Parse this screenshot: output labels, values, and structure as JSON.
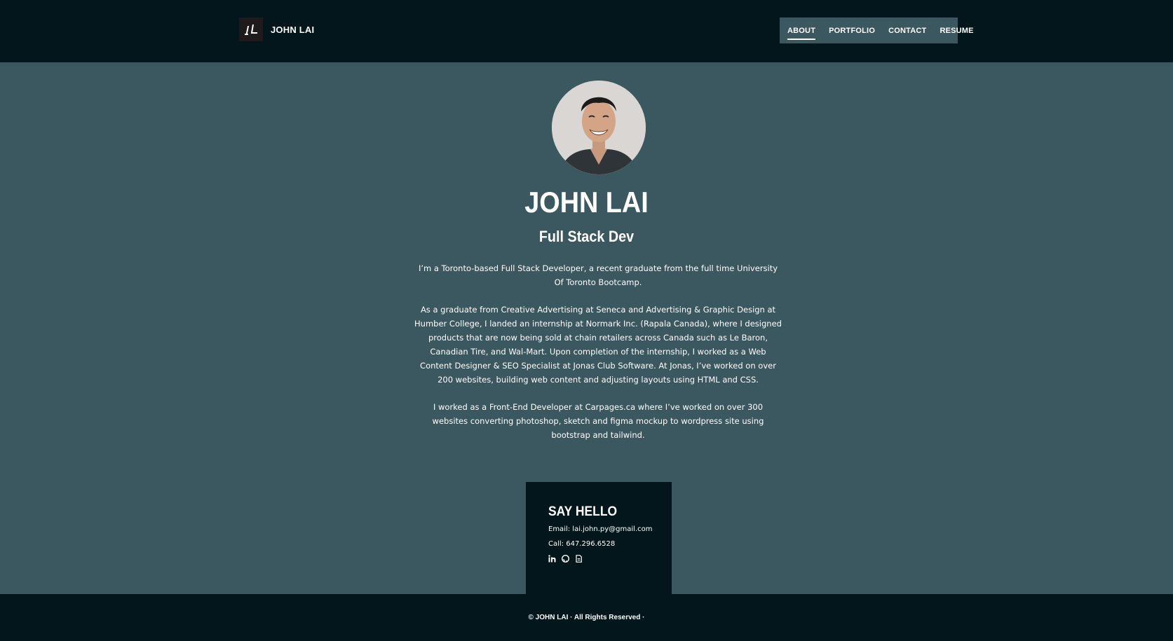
{
  "header": {
    "brand_name": "JOHN LAI",
    "logo_icon": "jl-monogram-icon",
    "nav": [
      {
        "label": "ABOUT",
        "active": true
      },
      {
        "label": "PORTFOLIO",
        "active": false
      },
      {
        "label": "CONTACT",
        "active": false
      },
      {
        "label": "RESUME",
        "active": false
      }
    ]
  },
  "hero": {
    "name": "JOHN LAI",
    "role": "Full Stack Dev",
    "bio": [
      "I’m a Toronto-based Full Stack Developer, a recent graduate from the full time University Of Toronto Bootcamp.",
      "As a graduate from Creative Advertising at Seneca and Advertising & Graphic Design at Humber College, I landed an internship at Normark Inc. (Rapala Canada), where I designed products that are now being sold at chain retailers across Canada such as Le Baron, Canadian Tire, and Wal-Mart. Upon completion of the internship, I worked as a Web Content Designer & SEO Specialist at Jonas Club Software. At Jonas, I’ve worked on over 200 websites, building web content and adjusting layouts using HTML and CSS.",
      "I worked as a Front-End Developer at Carpages.ca where I’ve worked on over 300 websites converting photoshop, sketch and figma mockup to wordpress site using bootstrap and tailwind."
    ]
  },
  "contact": {
    "title": "SAY HELLO",
    "email": "Email: lai.john.py@gmail.com",
    "phone": "Call: 647.296.6528",
    "icons": [
      "linkedin-icon",
      "github-icon",
      "resume-file-icon"
    ]
  },
  "footer": {
    "text": "© JOHN LAI · All Rights Reserved ·"
  },
  "colors": {
    "header_bg": "#02161b",
    "body_bg": "#3b5760",
    "nav_bg": "#3b5760",
    "text": "#ffffff"
  }
}
